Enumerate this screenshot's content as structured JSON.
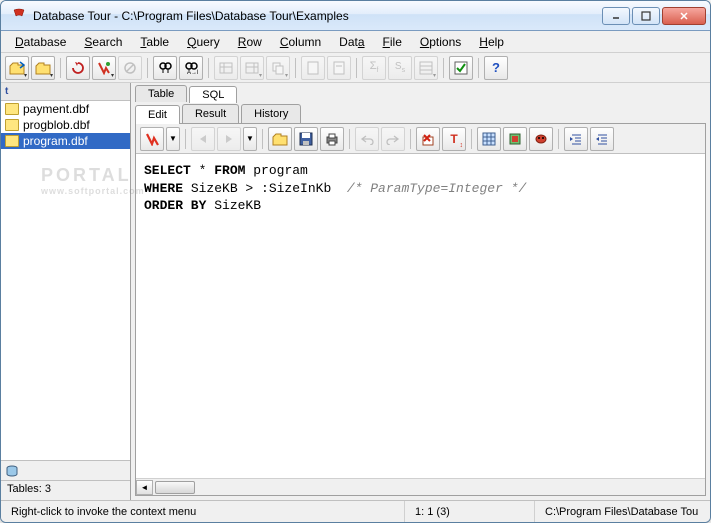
{
  "window": {
    "title": "Database Tour - C:\\Program Files\\Database Tour\\Examples"
  },
  "menu": {
    "items": [
      {
        "label": "Database",
        "u": 0
      },
      {
        "label": "Search",
        "u": 0
      },
      {
        "label": "Table",
        "u": 0
      },
      {
        "label": "Query",
        "u": 0
      },
      {
        "label": "Row",
        "u": 0
      },
      {
        "label": "Column",
        "u": 0
      },
      {
        "label": "Data",
        "u": 3
      },
      {
        "label": "File",
        "u": 0
      },
      {
        "label": "Options",
        "u": 0
      },
      {
        "label": "Help",
        "u": 0
      }
    ]
  },
  "sidebar": {
    "header_icon": "t",
    "items": [
      {
        "label": "payment.dbf",
        "selected": false
      },
      {
        "label": "progblob.dbf",
        "selected": false
      },
      {
        "label": "program.dbf",
        "selected": true
      }
    ],
    "status": "Tables: 3"
  },
  "main_tabs": {
    "row1": [
      {
        "label": "Table",
        "active": false
      },
      {
        "label": "SQL",
        "active": true
      }
    ],
    "row2": [
      {
        "label": "Edit",
        "active": true
      },
      {
        "label": "Result",
        "active": false
      },
      {
        "label": "History",
        "active": false
      }
    ]
  },
  "sql": {
    "line1_kw1": "SELECT",
    "line1_rest": " * ",
    "line1_kw2": "FROM",
    "line1_table": " program",
    "line2_kw": "WHERE",
    "line2_cond": " SizeKB > :SizeInKb  ",
    "line2_comment": "/* ParamType=Integer */",
    "line3_kw": "ORDER BY",
    "line3_col": " SizeKB"
  },
  "statusbar": {
    "hint": "Right-click to invoke the context menu",
    "pos": "1:  1 (3)",
    "path": "C:\\Program Files\\Database Tou"
  },
  "watermark": {
    "big": "PORTAL",
    "small": "www.softportal.com"
  }
}
